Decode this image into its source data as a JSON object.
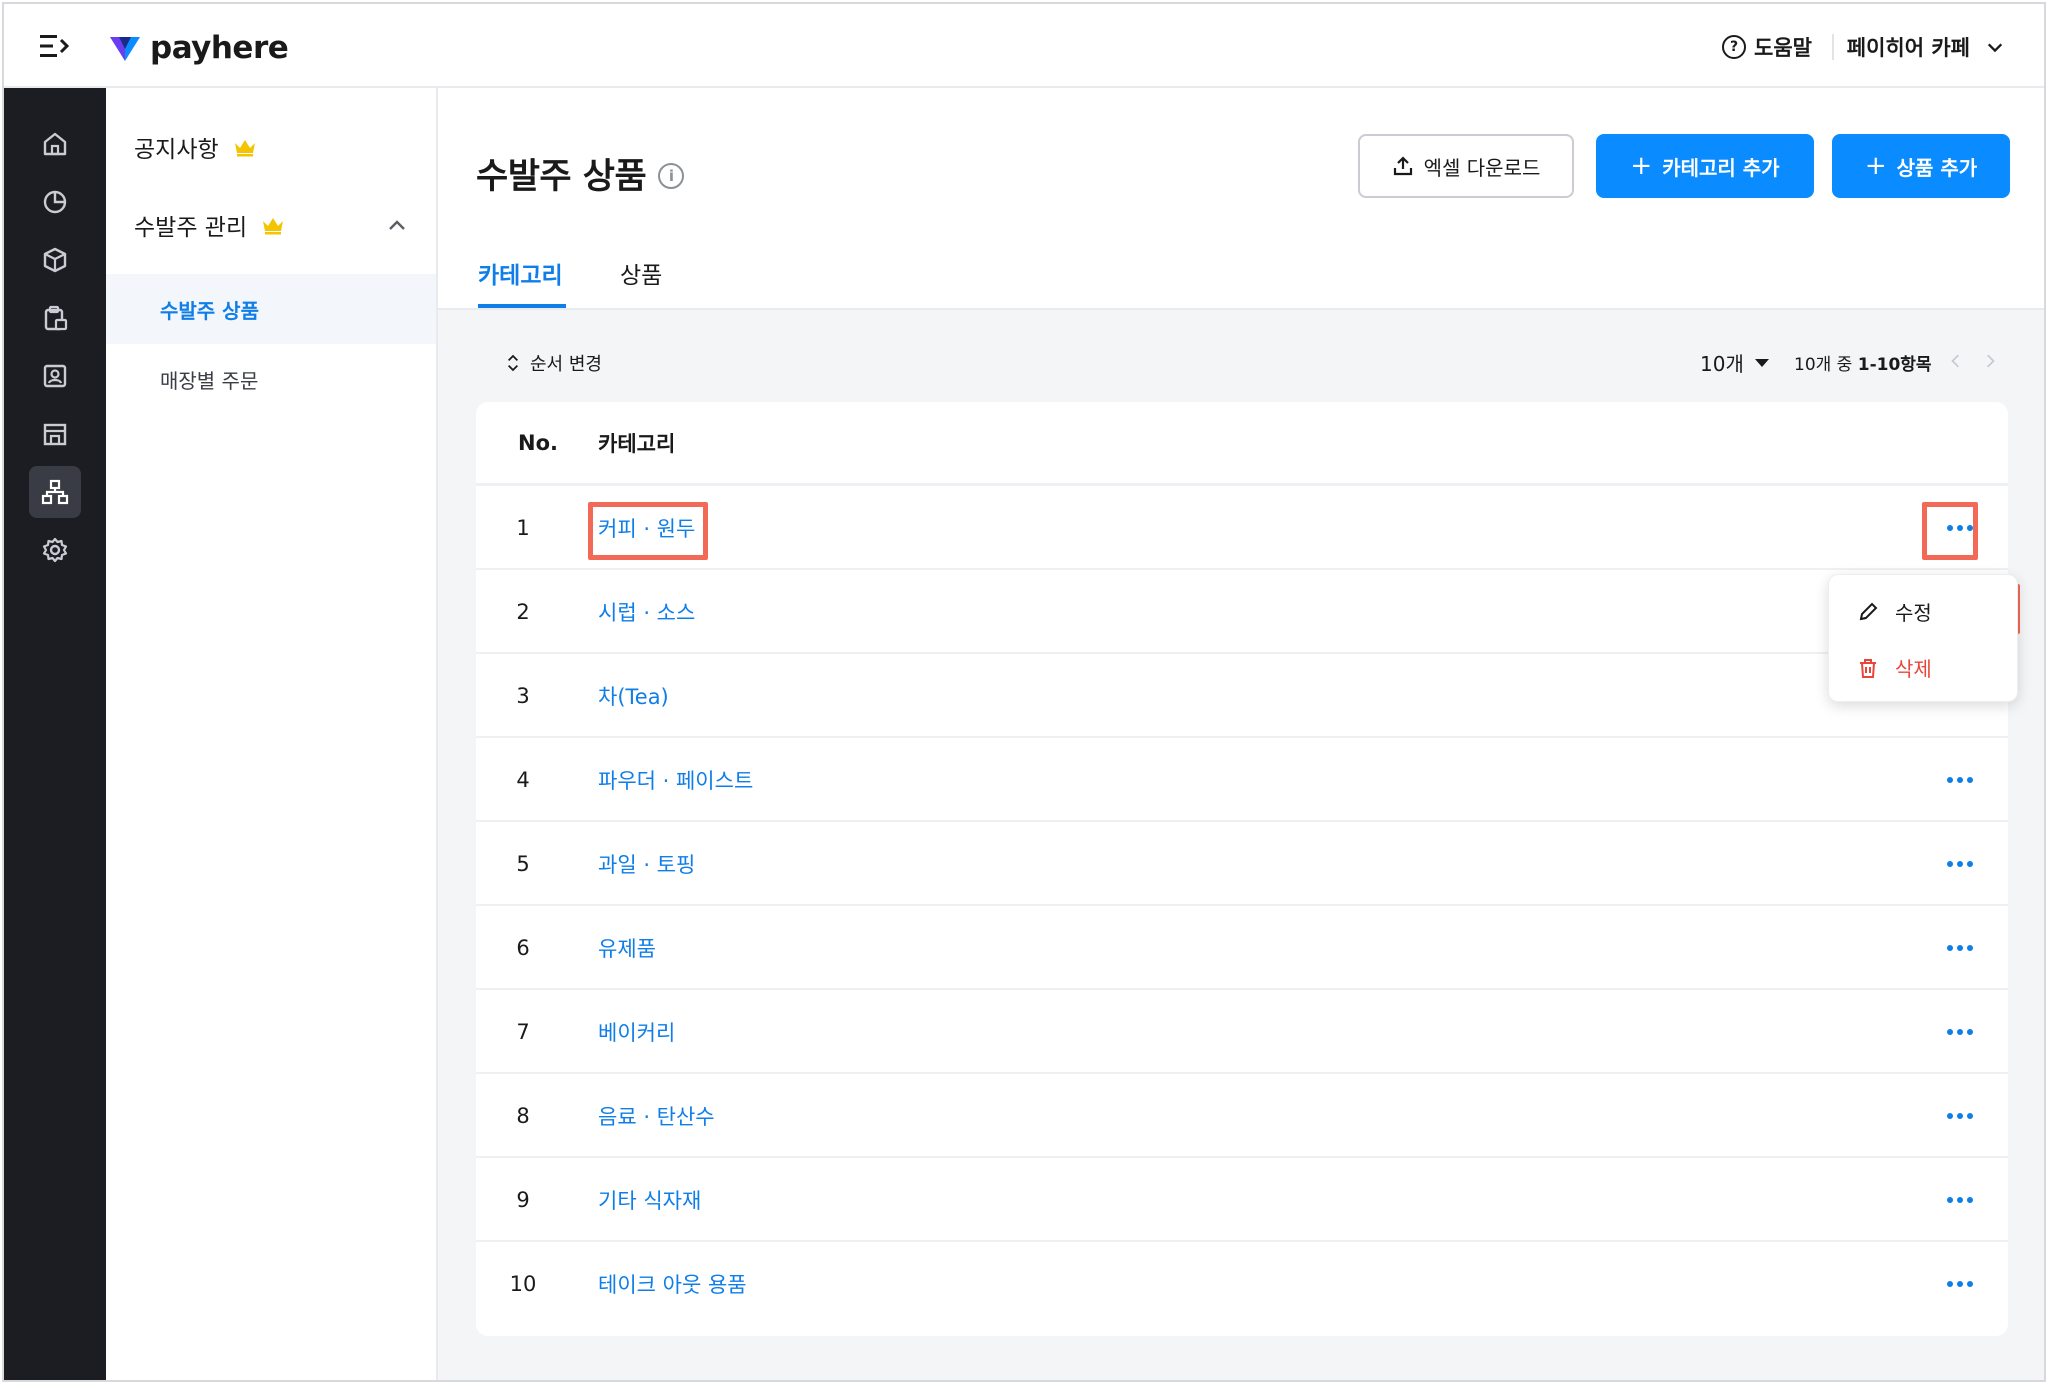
{
  "app": {
    "logo_text": "payhere"
  },
  "topbar": {
    "help_label": "도움말",
    "store_name": "페이히어 카페"
  },
  "colors": {
    "accent": "#0f7ee8",
    "primary_button": "#0a8bff",
    "rail_bg": "#1b1d22",
    "highlight": "#f26a57",
    "danger": "#e8463a",
    "crown": "#f5c400"
  },
  "rail": {
    "icons": [
      "home-icon",
      "chart-pie-icon",
      "box-icon",
      "clipboard-icon",
      "contact-icon",
      "store-icon",
      "org-chart-icon",
      "gear-icon"
    ],
    "active_index": 6
  },
  "sidebar": {
    "notice_label": "공지사항",
    "order_mgmt_label": "수발주 관리",
    "sub_items": [
      {
        "label": "수발주 상품",
        "active": true
      },
      {
        "label": "매장별 주문",
        "active": false
      }
    ]
  },
  "page": {
    "title": "수발주 상품",
    "buttons": {
      "excel": "엑셀 다운로드",
      "add_category": "카테고리 추가",
      "add_product": "상품 추가",
      "plus_glyph": "+"
    },
    "tabs": [
      {
        "label": "카테고리",
        "active": true
      },
      {
        "label": "상품",
        "active": false
      }
    ],
    "toolbar": {
      "reorder_label": "순서 변경",
      "page_size": "10개",
      "range_prefix": "10개 중",
      "range_value": "1-10항목"
    }
  },
  "table": {
    "headers": {
      "no": "No.",
      "category": "카테고리"
    },
    "rows": [
      {
        "no": "1",
        "category": "커피 · 원두"
      },
      {
        "no": "2",
        "category": "시럽 · 소스"
      },
      {
        "no": "3",
        "category": "차(Tea)"
      },
      {
        "no": "4",
        "category": "파우더 · 페이스트"
      },
      {
        "no": "5",
        "category": "과일 · 토핑"
      },
      {
        "no": "6",
        "category": "유제품"
      },
      {
        "no": "7",
        "category": "베이커리"
      },
      {
        "no": "8",
        "category": "음료 · 탄산수"
      },
      {
        "no": "9",
        "category": "기타 식자재"
      },
      {
        "no": "10",
        "category": "테이크 아웃 용품"
      }
    ]
  },
  "dropdown": {
    "edit_label": "수정",
    "delete_label": "삭제"
  }
}
